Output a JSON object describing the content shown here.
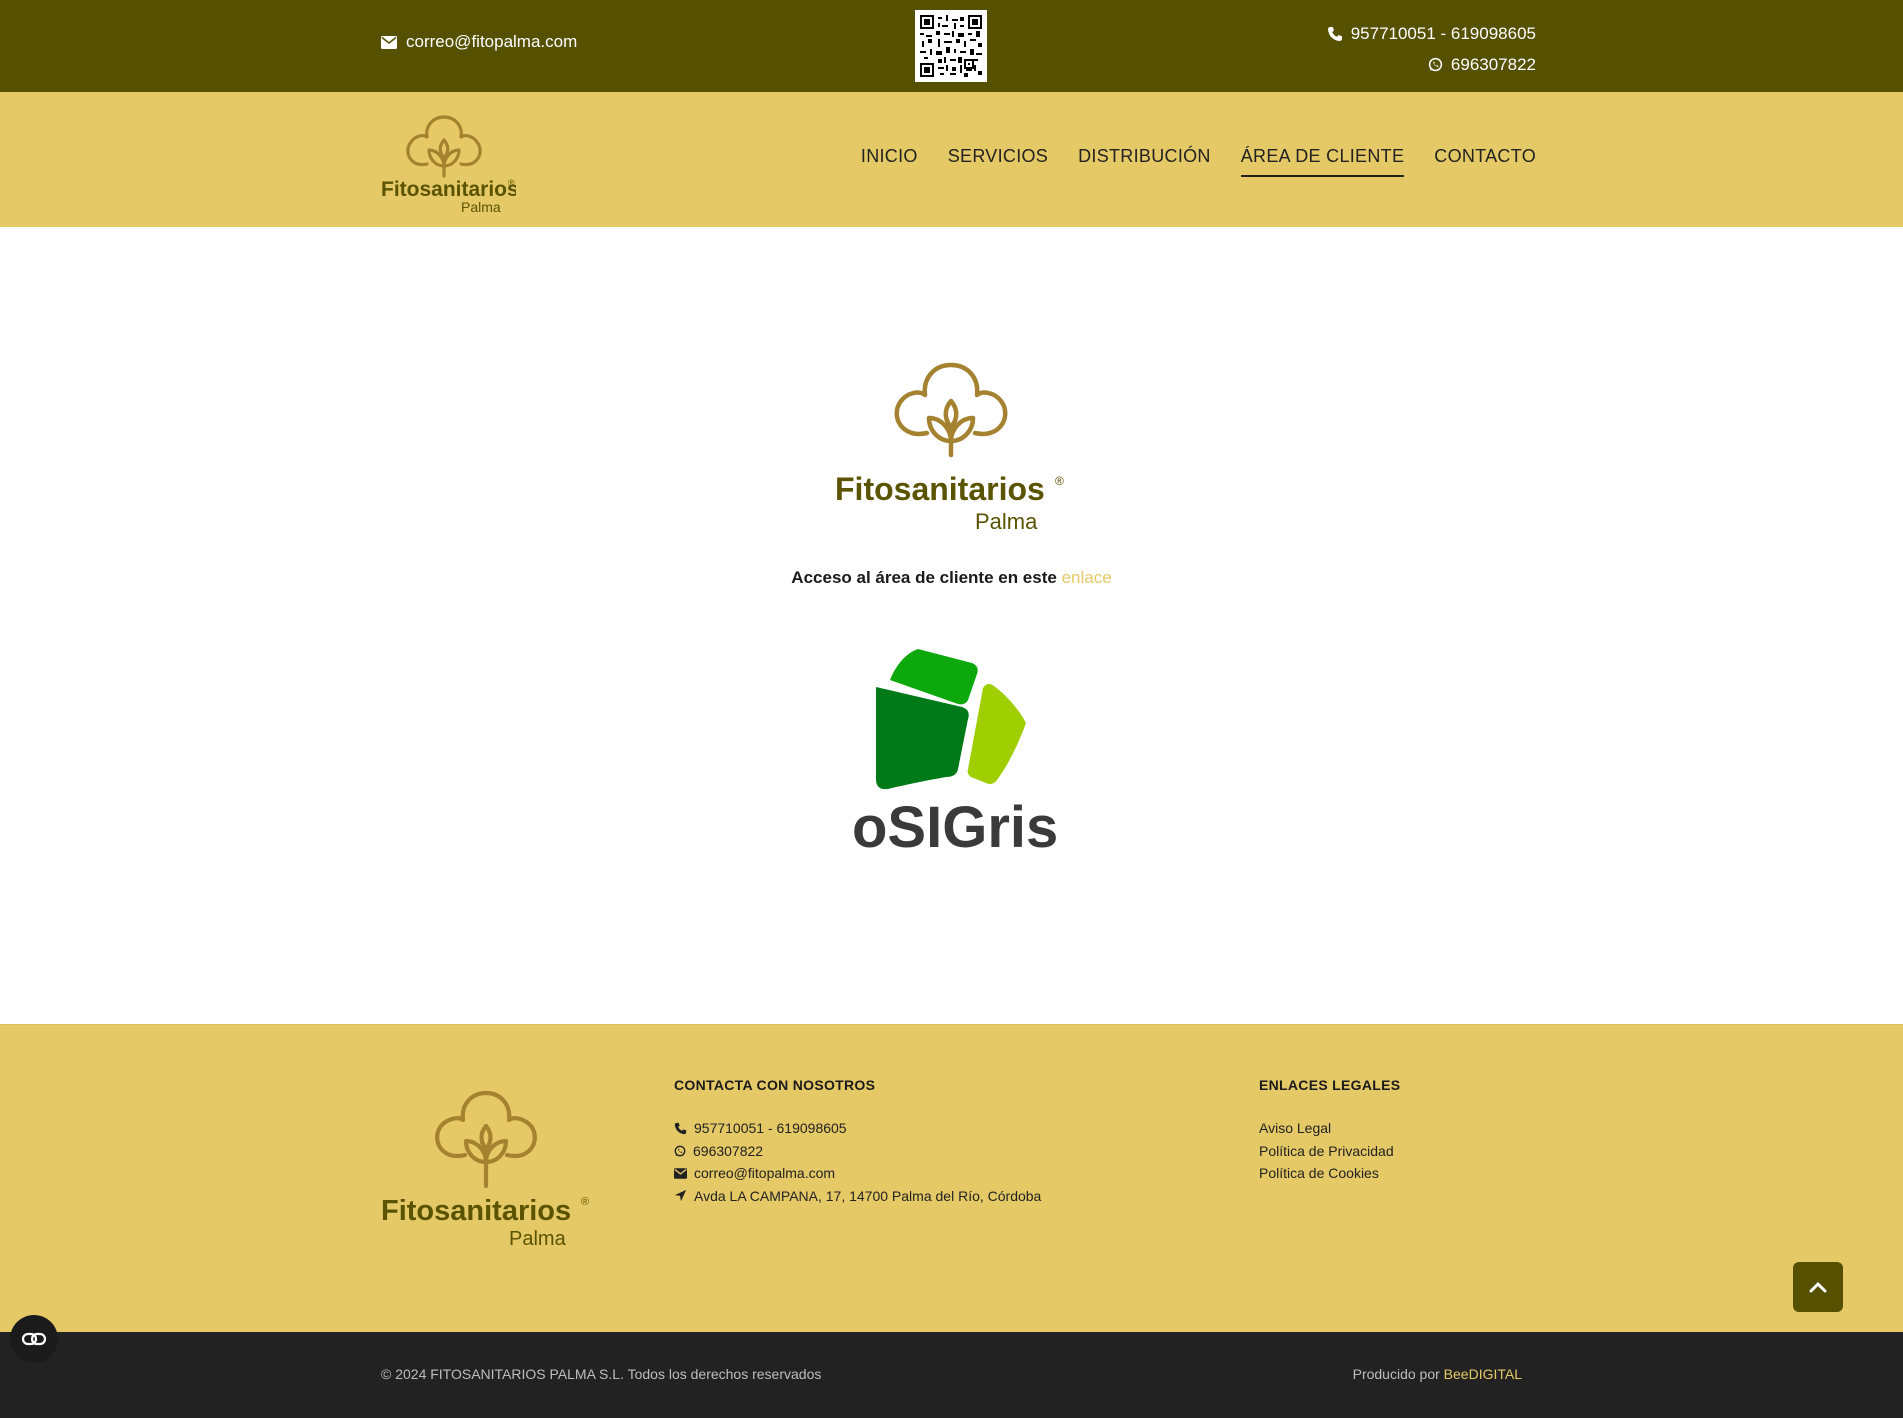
{
  "colors": {
    "topbar_bg": "#555100",
    "header_bg": "#e5c966",
    "logo_gold": "#a4822f",
    "logo_olive": "#5a5300",
    "link_accent": "#e5c966",
    "bottombar_bg": "#222222"
  },
  "topbar": {
    "email": "correo@fitopalma.com",
    "email_icon": "envelope-icon",
    "phones": "957710051 - 619098605",
    "phone_icon": "phone-icon",
    "whatsapp": "696307822",
    "whatsapp_icon": "whatsapp-icon"
  },
  "brand": {
    "name": "Fitosanitarios",
    "sub": "Palma",
    "reg": "®"
  },
  "nav": {
    "items": [
      {
        "label": "INICIO"
      },
      {
        "label": "SERVICIOS"
      },
      {
        "label": "DISTRIBUCIÓN"
      },
      {
        "label": "ÁREA DE CLIENTE",
        "active": true
      },
      {
        "label": "CONTACTO"
      }
    ]
  },
  "main": {
    "access_text": "Acceso al área de cliente en este",
    "access_link": "enlace",
    "osigris_label": "oSIGris"
  },
  "footer": {
    "contact_heading": "CONTACTA CON NOSOTROS",
    "phones": "957710051 - 619098605",
    "whatsapp": "696307822",
    "email": "correo@fitopalma.com",
    "address": "Avda LA CAMPANA, 17, 14700 Palma del Río, Córdoba",
    "legal_heading": "ENLACES LEGALES",
    "legal_links": [
      {
        "label": "Aviso Legal"
      },
      {
        "label": "Política de Privacidad"
      },
      {
        "label": "Política de Cookies"
      }
    ]
  },
  "bottombar": {
    "copyright": "© 2024 FITOSANITARIOS PALMA S.L. Todos los derechos reservados",
    "credit_prefix": "Producido por",
    "credit_link": "BeeDIGITAL"
  }
}
